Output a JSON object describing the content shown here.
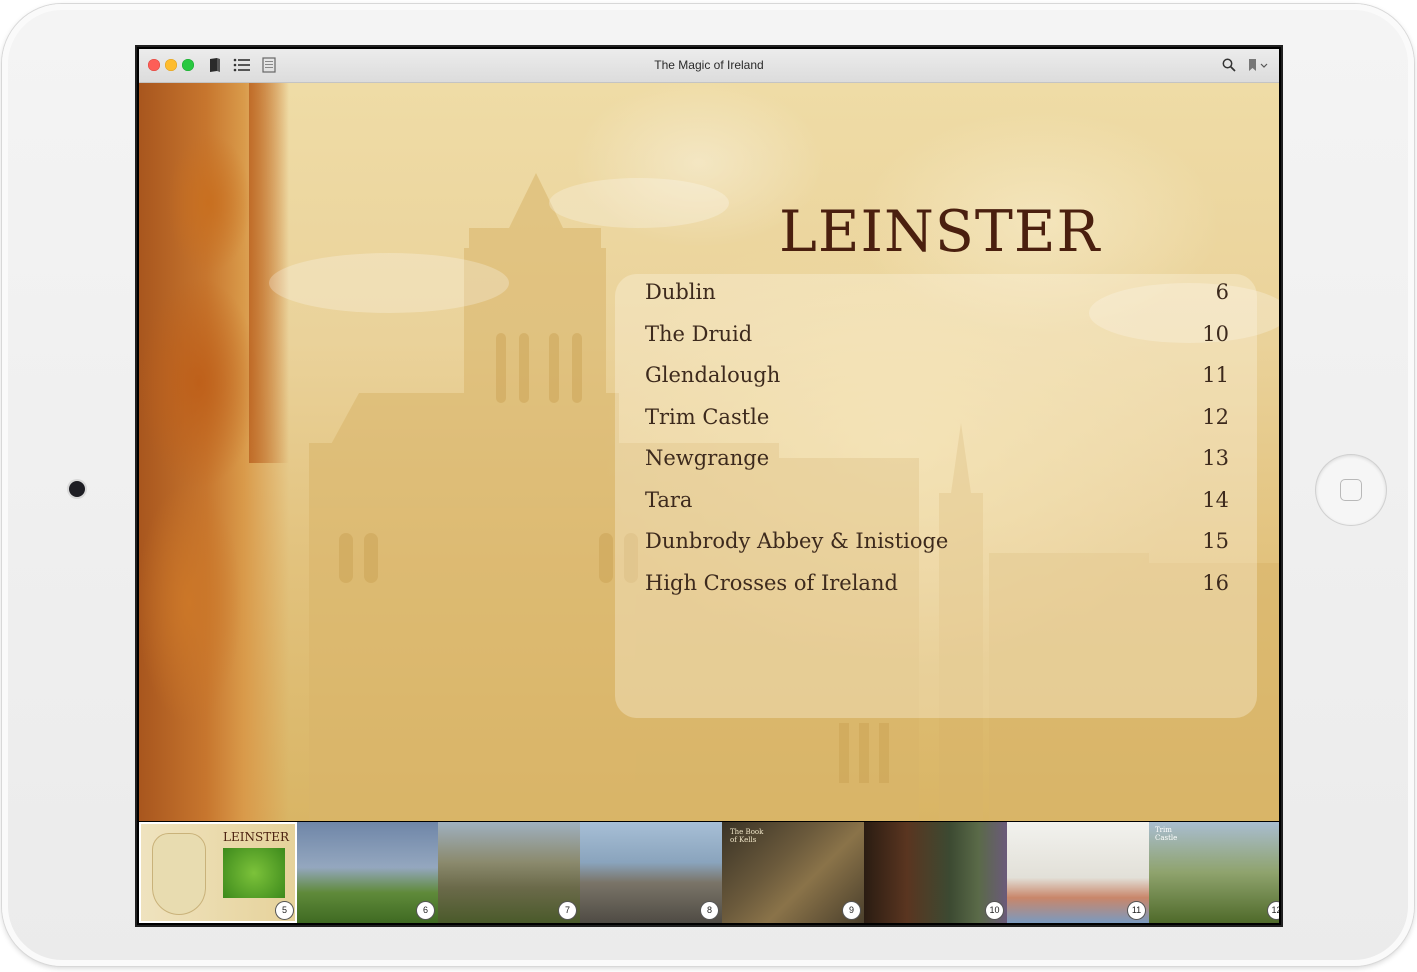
{
  "window": {
    "title": "The Magic of Ireland"
  },
  "page": {
    "heading": "LEINSTER",
    "toc": [
      {
        "title": "Dublin",
        "page": "6"
      },
      {
        "title": "The Druid",
        "page": "10"
      },
      {
        "title": "Glendalough",
        "page": "11"
      },
      {
        "title": "Trim Castle",
        "page": "12"
      },
      {
        "title": "Newgrange",
        "page": "13"
      },
      {
        "title": "Tara",
        "page": "14"
      },
      {
        "title": "Dunbrody Abbey & Inistioge",
        "page": "15"
      },
      {
        "title": "High Crosses of Ireland",
        "page": "16"
      }
    ]
  },
  "thumbnails": [
    {
      "page": "5",
      "title": "LEINSTER",
      "current": true
    },
    {
      "page": "6"
    },
    {
      "page": "7"
    },
    {
      "page": "8"
    },
    {
      "page": "9",
      "title": "The Book of Kells"
    },
    {
      "page": "10"
    },
    {
      "page": "11"
    },
    {
      "page": "12",
      "title": "Trim Castle"
    }
  ],
  "icons": {
    "sidebar": "book-icon",
    "toc": "list-icon",
    "view": "page-icon",
    "search": "search-icon",
    "bookmark": "bookmark-icon"
  },
  "colors": {
    "heading": "#4a1f0f",
    "toc_text": "#3d2a1d",
    "parchment": "#ead29a"
  }
}
